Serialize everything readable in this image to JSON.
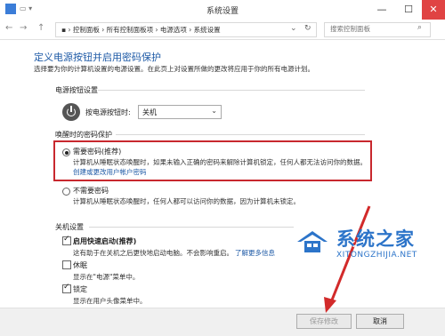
{
  "window": {
    "title": "系统设置",
    "minimize_glyph": "—",
    "maximize_glyph": "☐",
    "close_glyph": "✕"
  },
  "address": {
    "back_glyph": "←",
    "forward_glyph": "→",
    "up_glyph": "↑",
    "breadcrumb": "▪ › 控制面板 › 所有控制面板项 › 电源选项 › 系统设置",
    "dropdown_glyph": "⌄",
    "refresh_glyph": "↻",
    "search_placeholder": "搜索控制面板",
    "search_icon": "search-icon"
  },
  "content": {
    "title": "定义电源按钮并启用密码保护",
    "description": "选择要为你的计算机设置的电源设置。在此页上对设置所做的更改将应用于你的所有电源计划。",
    "power_button_section": "电源按钮设置",
    "power_button_label": "按电源按钮时:",
    "power_button_value": "关机",
    "wake_section": "唤醒时的密码保护",
    "require_password_title": "需要密码(推荐)",
    "require_password_desc": "计算机从睡眠状态唤醒时，如果未输入正确的密码来解除计算机锁定，任何人都无法访问你的数据。",
    "change_password_link": "创建或更改用户帐户密码",
    "no_password_title": "不需要密码",
    "no_password_desc": "计算机从睡眠状态唤醒时，任何人都可以访问你的数据，因为计算机未锁定。",
    "shutdown_section": "关机设置",
    "fast_startup_title": "启用快速启动(推荐)",
    "fast_startup_desc": "这有助于在关机之后更快地启动电脑。不会影响重启。",
    "learn_more_link": "了解更多信息",
    "sleep_title": "休眠",
    "sleep_desc": "显示在\"电源\"菜单中。",
    "lock_title": "锁定",
    "lock_desc": "显示在用户头像菜单中。"
  },
  "state": {
    "require_password_selected": true,
    "fast_startup_checked": true,
    "hibernate_checked": false,
    "lock_checked": true
  },
  "buttons": {
    "save": "保存修改",
    "cancel": "取消"
  },
  "watermark": {
    "main": "系统之家",
    "sub": "XITONGZHIJIA.NET"
  },
  "colors": {
    "accent": "#1e5aa6",
    "highlight_box": "#c8282e",
    "close_button": "#e04343"
  }
}
